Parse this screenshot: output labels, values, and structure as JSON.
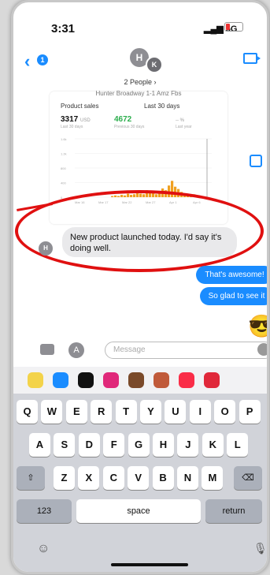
{
  "status": {
    "time": "3:31",
    "signal": "5G"
  },
  "header": {
    "avatar1": "H",
    "avatar2": "K",
    "people_label": "2 People"
  },
  "screenshot": {
    "title": "Hunter Broadway 1-1 Amz Fbs",
    "tab1": "Product sales",
    "tab2": "Last 30 days",
    "m1_value": "3317",
    "m1_unit": "USD",
    "m1_sub": "Last 30 days",
    "m2_value": "4672",
    "m2_sub": "Previous 30 days",
    "m3_value": "-- %",
    "m3_sub": "Last year",
    "y_ticks": [
      "1.6k",
      "1.2k",
      "800",
      "400",
      "0"
    ],
    "x_ticks": [
      "Mar 16",
      "Mar 17",
      "Mar 22",
      "Mar 27",
      "Apr 1",
      "Apr 6"
    ]
  },
  "messages": {
    "incoming": "New product launched today. I'd say it's doing well.",
    "incoming_avatar": "H",
    "out1": "That's awesome!",
    "out2": "So glad to see it",
    "emoji": "😎"
  },
  "input": {
    "placeholder": "Message"
  },
  "keyboard": {
    "row1": [
      "Q",
      "W",
      "E",
      "R",
      "T",
      "Y",
      "U",
      "I",
      "O",
      "P"
    ],
    "row2": [
      "A",
      "S",
      "D",
      "F",
      "G",
      "H",
      "J",
      "K",
      "L"
    ],
    "row3": [
      "Z",
      "X",
      "C",
      "V",
      "B",
      "N",
      "M"
    ],
    "num": "123",
    "space": "space",
    "return": "return"
  },
  "colors": {
    "accent": "#1a8cff",
    "bar": "#f0a020",
    "ring": "#e01010"
  },
  "chart_data": {
    "type": "bar",
    "values": [
      2,
      3,
      2,
      4,
      3,
      6,
      4,
      5,
      8,
      6,
      5,
      12,
      9,
      7,
      5,
      10,
      15,
      12,
      20,
      28,
      18,
      14,
      9,
      6,
      4,
      3,
      5
    ]
  }
}
